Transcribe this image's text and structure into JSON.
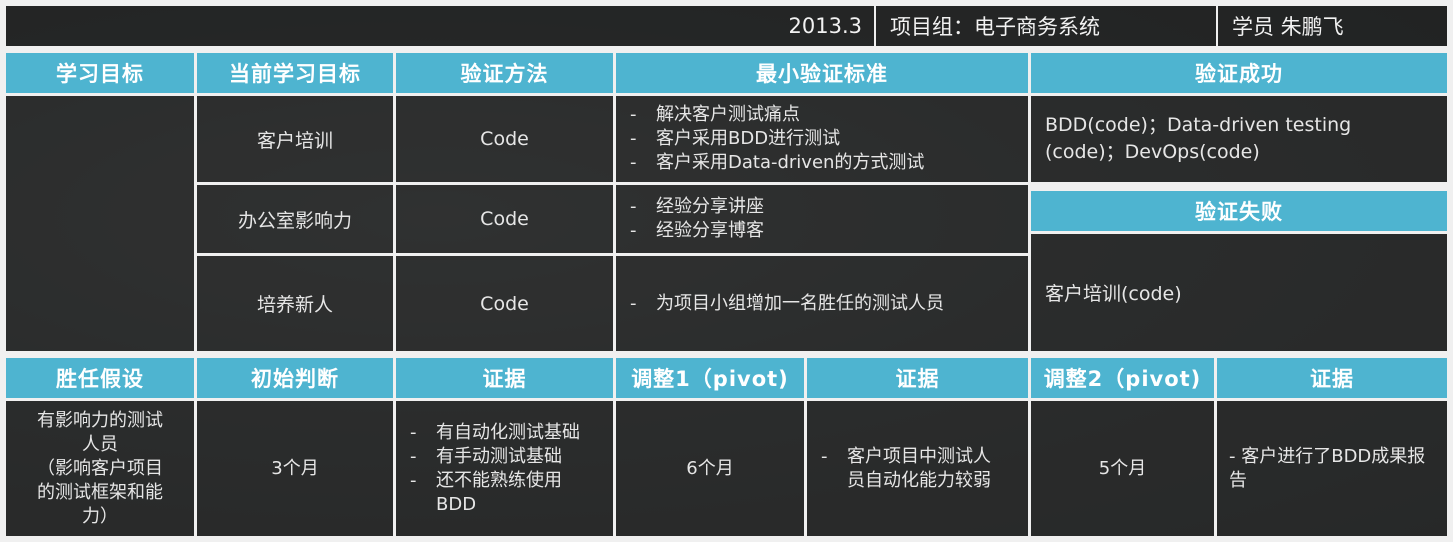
{
  "header": {
    "date": "2013.3",
    "project": "项目组：电子商务系统",
    "student": "学员 朱鹏飞"
  },
  "top_headers": {
    "learning_goal": "学习目标",
    "current_goal": "当前学习目标",
    "method": "验证方法",
    "min_standard": "最小验证标准",
    "success": "验证成功",
    "failure": "验证失败"
  },
  "rows": [
    {
      "goal": "客户培训",
      "method": "Code",
      "standards": [
        "解决客户测试痛点",
        "客户采用BDD进行测试",
        "客户采用Data-driven的方式测试"
      ]
    },
    {
      "goal": "办公室影响力",
      "method": "Code",
      "standards": [
        "经验分享讲座",
        "经验分享博客"
      ]
    },
    {
      "goal": "培养新人",
      "method": "Code",
      "standards": [
        "为项目小组增加一名胜任的测试人员"
      ]
    }
  ],
  "success_text": "BDD(code)；Data-driven testing (code)；DevOps(code)",
  "failure_text": "客户培训(code)",
  "bottom_headers": {
    "hypothesis": "胜任假设",
    "initial": "初始判断",
    "evidence1": "证据",
    "pivot1": "调整1（pivot)",
    "evidence2": "证据",
    "pivot2": "调整2（pivot)",
    "evidence3": "证据"
  },
  "bottom_row": {
    "hypothesis_line1": "有影响力的测试",
    "hypothesis_line2": "人员",
    "hypothesis_line3": "（影响客户项目",
    "hypothesis_line4": "的测试框架和能",
    "hypothesis_line5": "力）",
    "initial": "3个月",
    "evidence1": [
      "有自动化测试基础",
      "有手动测试基础",
      "还不能熟练使用BDD"
    ],
    "pivot1": "6个月",
    "evidence2": "客户项目中测试人员自动化能力较弱",
    "evidence2_dash": "-",
    "pivot2": "5个月",
    "evidence3": "- 客户进行了BDD成果报告"
  },
  "dash": "-"
}
